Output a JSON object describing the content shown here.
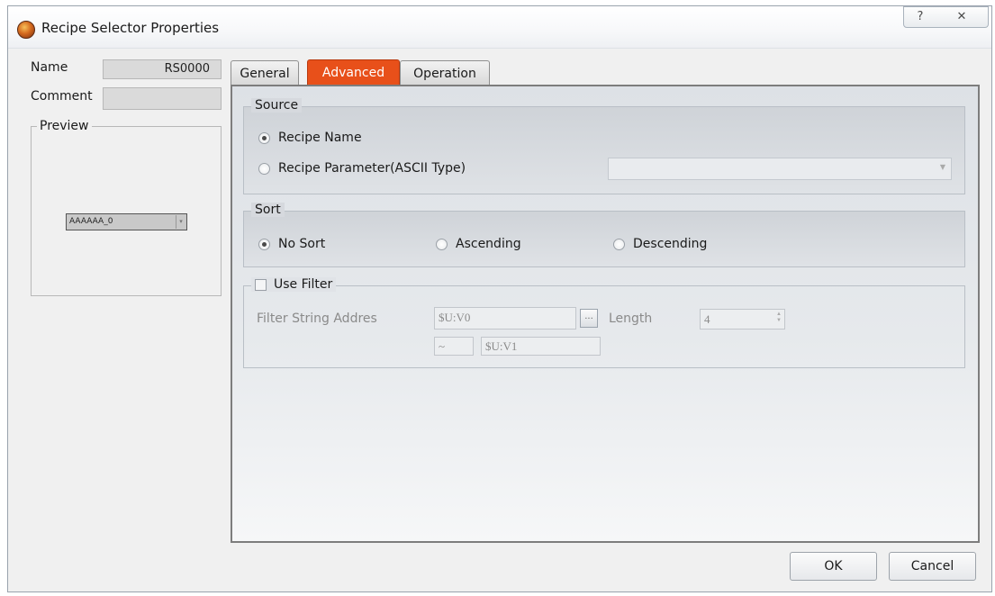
{
  "window": {
    "title": "Recipe Selector Properties",
    "help_glyph": "?",
    "close_glyph": "✕"
  },
  "left": {
    "name_label": "Name",
    "name_value": "RS0000",
    "comment_label": "Comment",
    "comment_value": "",
    "preview_label": "Preview",
    "preview_combo_value": "AAAAAA_0"
  },
  "tabs": [
    {
      "label": "General",
      "active": false
    },
    {
      "label": "Advanced",
      "active": true
    },
    {
      "label": "Operation",
      "active": false
    }
  ],
  "source": {
    "legend": "Source",
    "options": [
      {
        "label": "Recipe Name",
        "checked": true
      },
      {
        "label": "Recipe Parameter(ASCII Type)",
        "checked": false
      }
    ],
    "parameter_value": ""
  },
  "sort": {
    "legend": "Sort",
    "options": [
      {
        "label": "No Sort",
        "checked": true
      },
      {
        "label": "Ascending",
        "checked": false
      },
      {
        "label": "Descending",
        "checked": false
      }
    ]
  },
  "filter": {
    "checkbox_label": "Use Filter",
    "checked": false,
    "address_label": "Filter String Addres",
    "address_value": "$U:V0",
    "browse_label": "...",
    "length_label": "Length",
    "length_value": "4",
    "range_separator": "~",
    "end_address_value": "$U:V1"
  },
  "buttons": {
    "ok": "OK",
    "cancel": "Cancel"
  },
  "colors": {
    "active_tab": "#e8501a",
    "window_bg": "#f0f0f0"
  }
}
